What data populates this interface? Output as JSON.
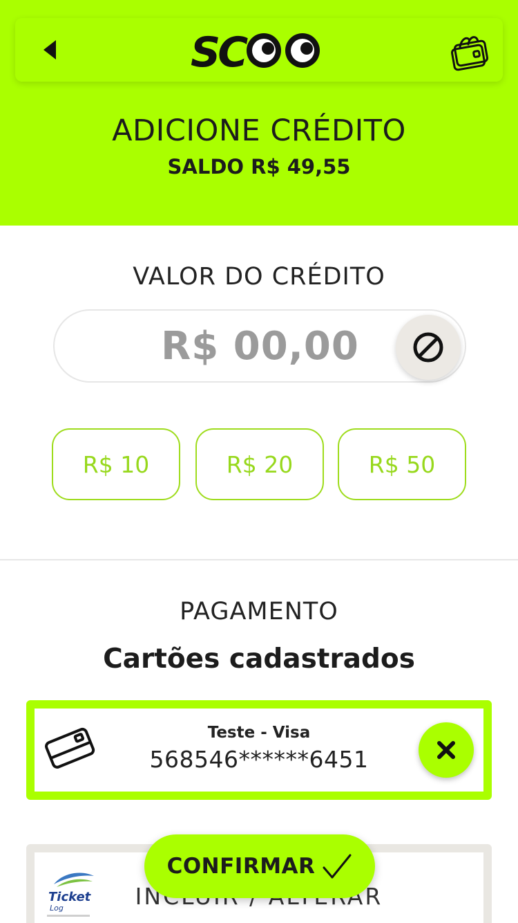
{
  "header": {
    "logo_text": "SCOO",
    "back_icon": "back-arrow-icon",
    "wallet_icon": "wallet-icon",
    "brand_color": "#aaff00"
  },
  "hero": {
    "title": "ADICIONE CRÉDITO",
    "balance": "SALDO R$ 49,55"
  },
  "credit": {
    "section_label": "VALOR DO CRÉDITO",
    "amount": "R$ 00,00",
    "clear_icon": "clear-icon",
    "presets": [
      "R$ 10",
      "R$ 20",
      "R$ 50"
    ]
  },
  "payment": {
    "section_label": "PAGAMENTO",
    "cards_title": "Cartões cadastrados",
    "cards": [
      {
        "name": "Teste - Visa",
        "number": "568546******6451",
        "icon": "credit-card-icon",
        "remove_icon": "close-icon",
        "selected": true
      }
    ],
    "ticket": {
      "label": "INCLUIR / ALTERAR",
      "logo_icon": "ticket-log-logo"
    }
  },
  "confirm": {
    "label": "CONFIRMAR",
    "icon": "checkmark-icon"
  }
}
